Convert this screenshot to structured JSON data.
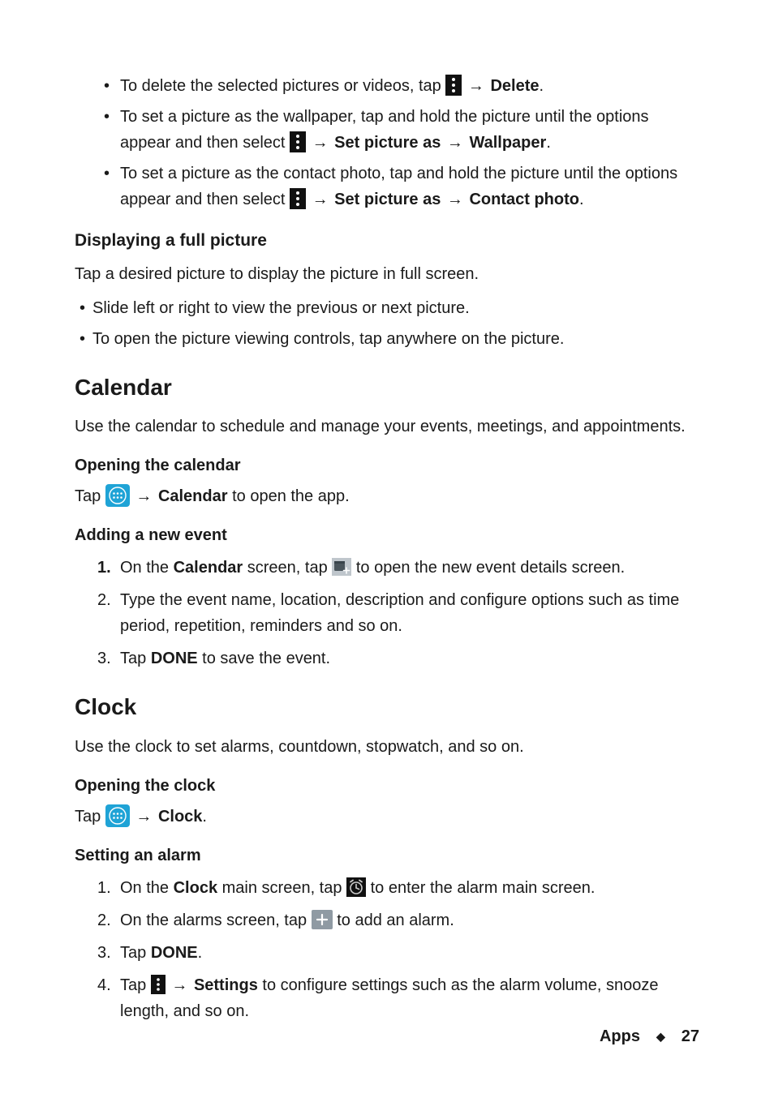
{
  "arrow": "→",
  "gallery": {
    "bullets": [
      {
        "pre": "To delete the selected pictures or videos, tap ",
        "icon": "overflow-menu-icon",
        "post_seq": [
          " ",
          "→",
          " "
        ],
        "bold1": "Delete",
        "tail": "."
      },
      {
        "pre": "To set a picture as the wallpaper, tap and hold the picture until the options appear and then select ",
        "icon": "overflow-menu-icon",
        "post_seq": [
          " ",
          "→",
          " "
        ],
        "bold1": "Set picture as",
        "mid_seq": [
          " ",
          "→",
          " "
        ],
        "bold2": "Wallpaper",
        "tail": "."
      },
      {
        "pre": "To set a picture as the contact photo, tap and hold the picture until the options appear and then select ",
        "icon": "overflow-menu-icon",
        "post_seq": [
          " ",
          "→",
          " "
        ],
        "bold1": "Set picture as",
        "mid_seq": [
          " ",
          "→",
          " "
        ],
        "bold2": "Contact photo",
        "tail": "."
      }
    ],
    "displaying_heading": "Displaying a full picture",
    "displaying_text": "Tap a desired picture to display the picture in full screen.",
    "displaying_bullets": [
      "Slide left or right to view the previous  or next picture.",
      "To open the picture viewing controls, tap anywhere on the picture."
    ]
  },
  "calendar": {
    "heading": "Calendar",
    "intro": "Use the calendar to schedule and manage your events, meetings, and appointments.",
    "opening_heading": "Opening the calendar",
    "opening_line": {
      "pre": "Tap ",
      "icon": "apps-grid-icon",
      "seq": [
        " ",
        "→",
        " "
      ],
      "bold": "Calendar",
      "tail": " to open the app."
    },
    "adding_heading": "Adding a new event",
    "steps": [
      {
        "pre": "On the ",
        "bold1": "Calendar",
        "mid": " screen, tap ",
        "icon": "new-event-icon",
        "tail": " to open the new event details screen."
      },
      {
        "plain": "Type the event name, location, description and configure options such as time period, repetition, reminders and so on."
      },
      {
        "pre": "Tap ",
        "bold1": "DONE",
        "tail": " to save the event."
      }
    ]
  },
  "clock": {
    "heading": "Clock",
    "intro": "Use the clock to set alarms, countdown, stopwatch, and so on.",
    "opening_heading": "Opening the clock",
    "opening_line": {
      "pre": "Tap ",
      "icon": "apps-grid-icon",
      "seq": [
        " ",
        "→",
        " "
      ],
      "bold": "Clock",
      "tail": "."
    },
    "setting_heading": "Setting an alarm",
    "steps": [
      {
        "pre": "On the ",
        "bold1": "Clock",
        "mid": " main screen, tap ",
        "icon": "alarm-clock-icon",
        "tail": " to enter the alarm main screen."
      },
      {
        "pre": "On the alarms screen, tap ",
        "icon": "add-plus-icon",
        "tail": " to add an alarm."
      },
      {
        "pre": "Tap ",
        "bold1": "DONE",
        "tail": "."
      },
      {
        "pre": "Tap ",
        "icon": "overflow-menu-icon",
        "seq": [
          " ",
          "→",
          "  "
        ],
        "bold1": "Settings",
        "tail": " to configure settings such as the alarm volume, snooze length, and so on."
      }
    ]
  },
  "footer": {
    "section": "Apps",
    "page": "27"
  }
}
